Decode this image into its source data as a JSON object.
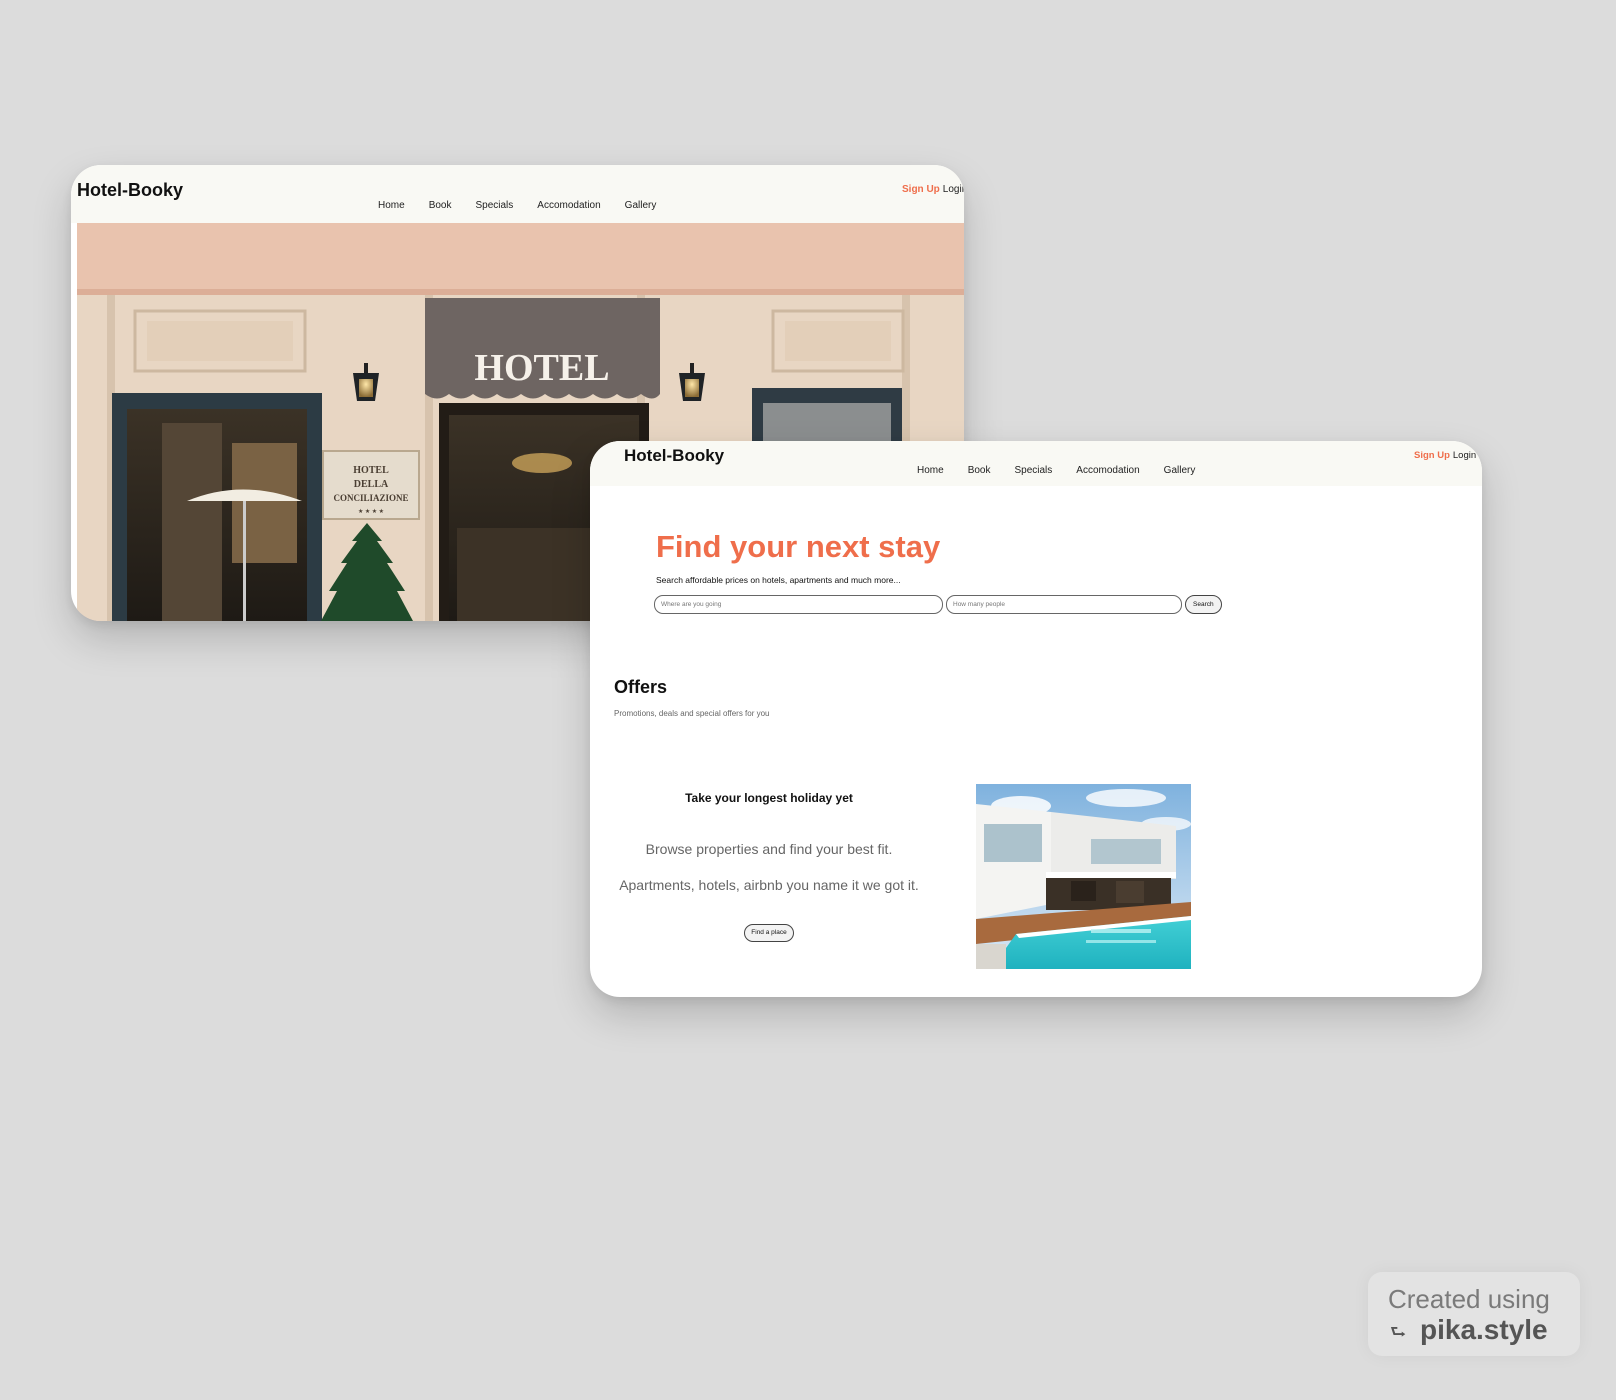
{
  "colors": {
    "background": "#dcdcdc",
    "accent": "#ef6e4b",
    "navbar": "#f9f9f4"
  },
  "back_page": {
    "logo": "Hotel-Booky",
    "nav": [
      "Home",
      "Book",
      "Specials",
      "Accomodation",
      "Gallery"
    ],
    "signup": "Sign Up",
    "login": "Login",
    "hero": {
      "awning_text": "HOTEL",
      "plaque_lines": [
        "HOTEL",
        "DELLA",
        "CONCILIAZIONE"
      ],
      "plaque_stars": "★ ★ ★ ★"
    }
  },
  "front_page": {
    "logo": "Hotel-Booky",
    "nav": [
      "Home",
      "Book",
      "Specials",
      "Accomodation",
      "Gallery"
    ],
    "signup": "Sign Up",
    "login": "Login",
    "headline": "Find your next stay",
    "subtext": "Search affordable prices on hotels, apartments and much more...",
    "search": {
      "where_placeholder": "Where are you going",
      "people_placeholder": "How many people",
      "button": "Search"
    },
    "offers": {
      "title": "Offers",
      "subtitle": "Promotions, deals and special offers for you"
    },
    "promo": {
      "title": "Take your longest holiday yet",
      "line1": "Browse properties and find your best fit.",
      "line2": "Apartments, hotels, airbnb you name it we got it.",
      "button": "Find a place"
    }
  },
  "watermark": {
    "line1": "Created using",
    "arrow": "⮑",
    "line2": "pika.style"
  }
}
